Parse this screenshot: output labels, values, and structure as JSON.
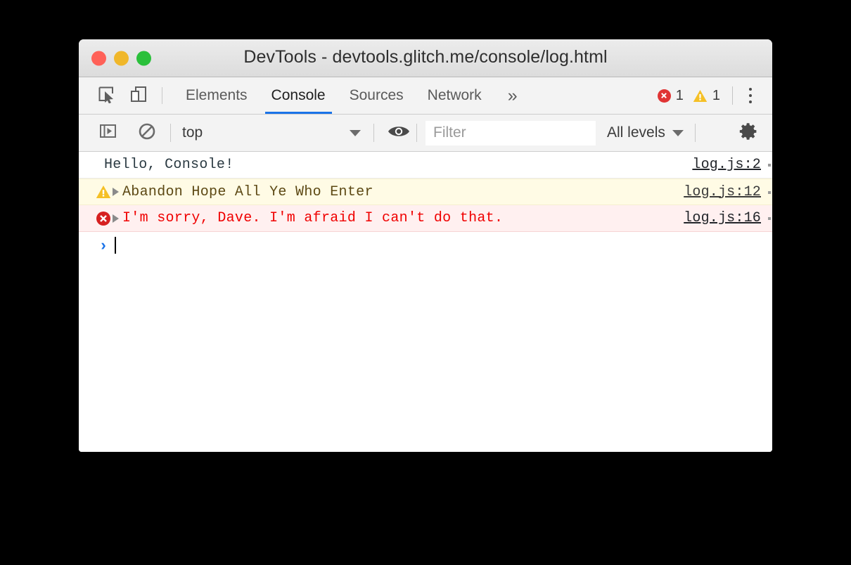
{
  "window": {
    "title": "DevTools - devtools.glitch.me/console/log.html",
    "controls": {
      "close": "close-window",
      "minimize": "minimize-window",
      "maximize": "maximize-window"
    },
    "accent_color": "#1a73e8",
    "close_color": "#ff6158",
    "minimize_color": "#f0b72a",
    "maximize_color": "#2ac03b"
  },
  "main_toolbar": {
    "inspect_icon": "inspect-element-icon",
    "device_icon": "device-toolbar-icon",
    "tabs": [
      {
        "label": "Elements",
        "active": false
      },
      {
        "label": "Console",
        "active": true
      },
      {
        "label": "Sources",
        "active": false
      },
      {
        "label": "Network",
        "active": false
      }
    ],
    "more_tabs_label": "»",
    "error_count": "1",
    "warning_count": "1",
    "error_icon": "error-circle-icon",
    "warning_icon": "warning-triangle-icon",
    "menu_icon": "kebab-menu-icon"
  },
  "console_toolbar": {
    "sidebar_icon": "console-sidebar-toggle-icon",
    "clear_icon": "clear-console-icon",
    "context": {
      "value": "top",
      "caret": "chevron-down-icon"
    },
    "live_expression_icon": "eye-icon",
    "filter": {
      "value": "",
      "placeholder": "Filter"
    },
    "levels": {
      "value": "All levels",
      "caret": "chevron-down-icon"
    },
    "settings_icon": "gear-icon"
  },
  "console": {
    "messages": [
      {
        "level": "log",
        "icon": "",
        "expandable": false,
        "text": "Hello, Console!",
        "source": "log.js:2"
      },
      {
        "level": "warning",
        "icon": "warning-triangle-icon",
        "expandable": true,
        "text": "Abandon Hope All Ye Who Enter",
        "source": "log.js:12"
      },
      {
        "level": "error",
        "icon": "error-circle-icon",
        "expandable": true,
        "text": "I'm sorry, Dave. I'm afraid I can't do that.",
        "source": "log.js:16"
      }
    ],
    "prompt": {
      "arrow": "›",
      "value": ""
    }
  }
}
